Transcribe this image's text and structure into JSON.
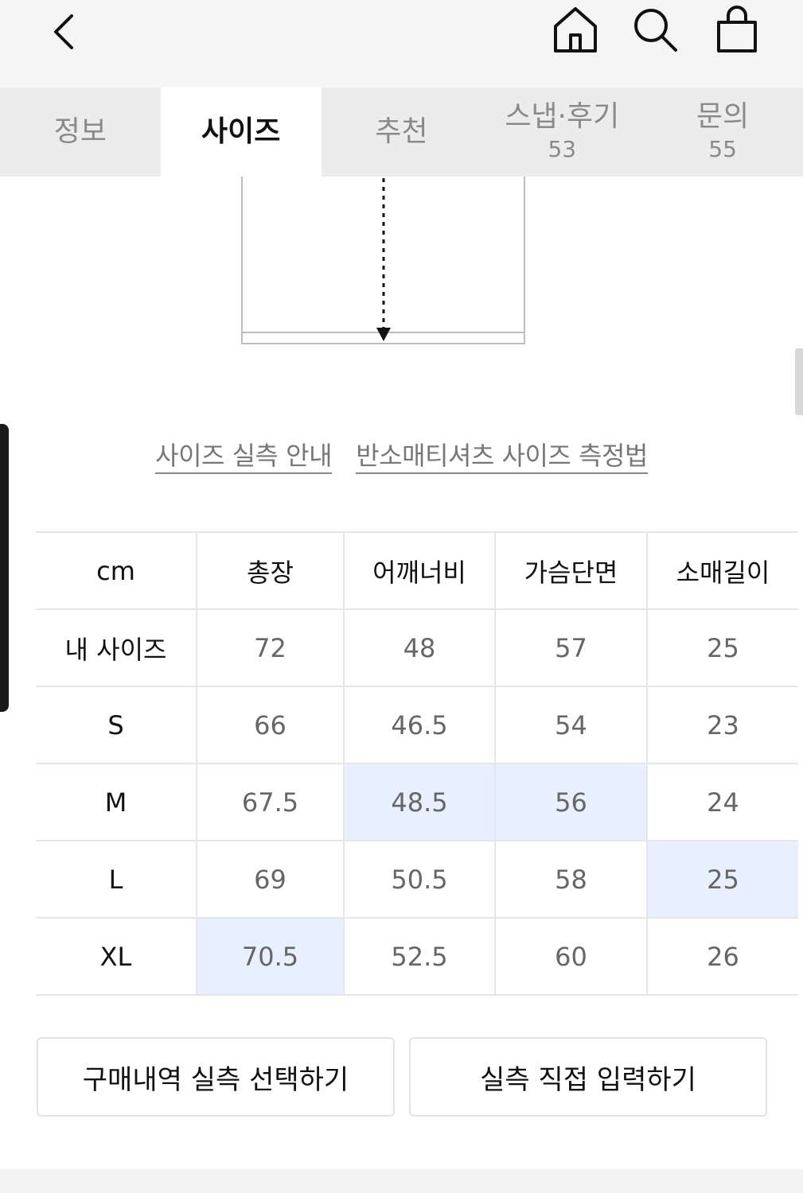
{
  "tabs": [
    {
      "label": "정보",
      "count": ""
    },
    {
      "label": "사이즈",
      "count": ""
    },
    {
      "label": "추천",
      "count": ""
    },
    {
      "label": "스냅·후기",
      "count": "53"
    },
    {
      "label": "문의",
      "count": "55"
    }
  ],
  "active_tab": "사이즈",
  "links": {
    "measure_guide": "사이즈 실측 안내",
    "method": "반소매티셔츠 사이즈 측정법"
  },
  "size_table": {
    "headers": [
      "cm",
      "총장",
      "어깨너비",
      "가슴단면",
      "소매길이"
    ],
    "rows": [
      {
        "label": "내 사이즈",
        "values": [
          "72",
          "48",
          "57",
          "25"
        ]
      },
      {
        "label": "S",
        "values": [
          "66",
          "46.5",
          "54",
          "23"
        ]
      },
      {
        "label": "M",
        "values": [
          "67.5",
          "48.5",
          "56",
          "24"
        ]
      },
      {
        "label": "L",
        "values": [
          "69",
          "50.5",
          "58",
          "25"
        ]
      },
      {
        "label": "XL",
        "values": [
          "70.5",
          "52.5",
          "60",
          "26"
        ]
      }
    ],
    "highlight_color": "#e8efff"
  },
  "buttons": {
    "purchase_history": "구매내역 실측 선택하기",
    "direct_input": "실측 직접 입력하기"
  },
  "icons": {
    "back": "chevron-left-icon",
    "home": "home-icon",
    "search": "search-icon",
    "bag": "shopping-bag-icon"
  }
}
